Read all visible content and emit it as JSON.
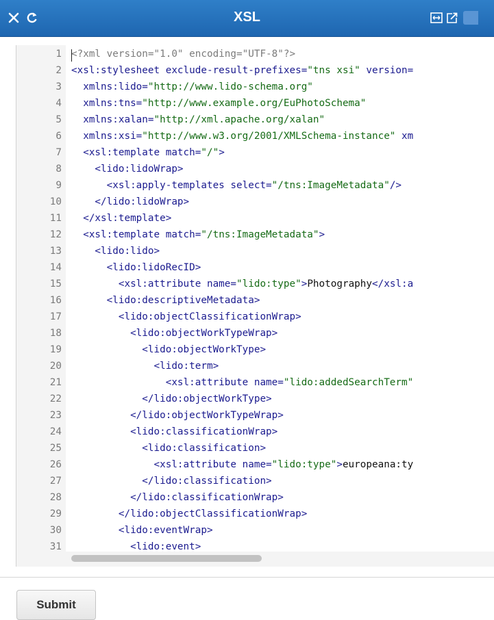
{
  "header": {
    "title": "XSL",
    "close_icon": "close-icon",
    "refresh_icon": "refresh-icon",
    "expand_icon": "expand-icon",
    "share_icon": "share-icon"
  },
  "colors": {
    "header_bg": "#1e66b0",
    "tag": "#1b1b8f",
    "attr_value": "#166b16",
    "line_number": "#7a7a7a"
  },
  "editor": {
    "lines": [
      {
        "n": "1",
        "segments": [
          {
            "t": "<?xml version=\"1.0\" encoding=\"UTF-8\"?>",
            "c": "pi"
          }
        ]
      },
      {
        "n": "2",
        "segments": [
          {
            "t": "<xsl:stylesheet exclude-result-prefixes=",
            "c": "tag"
          },
          {
            "t": "\"tns xsi\"",
            "c": "val"
          },
          {
            "t": " version=",
            "c": "tag"
          }
        ]
      },
      {
        "n": "3",
        "segments": [
          {
            "t": "  xmlns:lido=",
            "c": "tag"
          },
          {
            "t": "\"http://www.lido-schema.org\"",
            "c": "val"
          }
        ]
      },
      {
        "n": "4",
        "segments": [
          {
            "t": "  xmlns:tns=",
            "c": "tag"
          },
          {
            "t": "\"http://www.example.org/EuPhotoSchema\"",
            "c": "val"
          }
        ]
      },
      {
        "n": "5",
        "segments": [
          {
            "t": "  xmlns:xalan=",
            "c": "tag"
          },
          {
            "t": "\"http://xml.apache.org/xalan\"",
            "c": "val"
          }
        ]
      },
      {
        "n": "6",
        "segments": [
          {
            "t": "  xmlns:xsi=",
            "c": "tag"
          },
          {
            "t": "\"http://www.w3.org/2001/XMLSchema-instance\"",
            "c": "val"
          },
          {
            "t": " xm",
            "c": "tag"
          }
        ]
      },
      {
        "n": "7",
        "segments": [
          {
            "t": "  <xsl:template match=",
            "c": "tag"
          },
          {
            "t": "\"/\"",
            "c": "val"
          },
          {
            "t": ">",
            "c": "tag"
          }
        ]
      },
      {
        "n": "8",
        "segments": [
          {
            "t": "    <lido:lidoWrap>",
            "c": "tag"
          }
        ]
      },
      {
        "n": "9",
        "segments": [
          {
            "t": "      <xsl:apply-templates select=",
            "c": "tag"
          },
          {
            "t": "\"/tns:ImageMetadata\"",
            "c": "val"
          },
          {
            "t": "/>",
            "c": "tag"
          }
        ]
      },
      {
        "n": "10",
        "segments": [
          {
            "t": "    </lido:lidoWrap>",
            "c": "tag"
          }
        ]
      },
      {
        "n": "11",
        "segments": [
          {
            "t": "  </xsl:template>",
            "c": "tag"
          }
        ]
      },
      {
        "n": "12",
        "segments": [
          {
            "t": "  <xsl:template match=",
            "c": "tag"
          },
          {
            "t": "\"/tns:ImageMetadata\"",
            "c": "val"
          },
          {
            "t": ">",
            "c": "tag"
          }
        ]
      },
      {
        "n": "13",
        "segments": [
          {
            "t": "    <lido:lido>",
            "c": "tag"
          }
        ]
      },
      {
        "n": "14",
        "segments": [
          {
            "t": "      <lido:lidoRecID>",
            "c": "tag"
          }
        ]
      },
      {
        "n": "15",
        "segments": [
          {
            "t": "        <xsl:attribute name=",
            "c": "tag"
          },
          {
            "t": "\"lido:type\"",
            "c": "val"
          },
          {
            "t": ">",
            "c": "tag"
          },
          {
            "t": "Photography",
            "c": "txt"
          },
          {
            "t": "</xsl:a",
            "c": "tag"
          }
        ]
      },
      {
        "n": "16",
        "segments": [
          {
            "t": "      <lido:descriptiveMetadata>",
            "c": "tag"
          }
        ]
      },
      {
        "n": "17",
        "segments": [
          {
            "t": "        <lido:objectClassificationWrap>",
            "c": "tag"
          }
        ]
      },
      {
        "n": "18",
        "segments": [
          {
            "t": "          <lido:objectWorkTypeWrap>",
            "c": "tag"
          }
        ]
      },
      {
        "n": "19",
        "segments": [
          {
            "t": "            <lido:objectWorkType>",
            "c": "tag"
          }
        ]
      },
      {
        "n": "20",
        "segments": [
          {
            "t": "              <lido:term>",
            "c": "tag"
          }
        ]
      },
      {
        "n": "21",
        "segments": [
          {
            "t": "                <xsl:attribute name=",
            "c": "tag"
          },
          {
            "t": "\"lido:addedSearchTerm\"",
            "c": "val"
          }
        ]
      },
      {
        "n": "22",
        "segments": [
          {
            "t": "            </lido:objectWorkType>",
            "c": "tag"
          }
        ]
      },
      {
        "n": "23",
        "segments": [
          {
            "t": "          </lido:objectWorkTypeWrap>",
            "c": "tag"
          }
        ]
      },
      {
        "n": "24",
        "segments": [
          {
            "t": "          <lido:classificationWrap>",
            "c": "tag"
          }
        ]
      },
      {
        "n": "25",
        "segments": [
          {
            "t": "            <lido:classification>",
            "c": "tag"
          }
        ]
      },
      {
        "n": "26",
        "segments": [
          {
            "t": "              <xsl:attribute name=",
            "c": "tag"
          },
          {
            "t": "\"lido:type\"",
            "c": "val"
          },
          {
            "t": ">",
            "c": "tag"
          },
          {
            "t": "europeana:ty",
            "c": "txt"
          }
        ]
      },
      {
        "n": "27",
        "segments": [
          {
            "t": "            </lido:classification>",
            "c": "tag"
          }
        ]
      },
      {
        "n": "28",
        "segments": [
          {
            "t": "          </lido:classificationWrap>",
            "c": "tag"
          }
        ]
      },
      {
        "n": "29",
        "segments": [
          {
            "t": "        </lido:objectClassificationWrap>",
            "c": "tag"
          }
        ]
      },
      {
        "n": "30",
        "segments": [
          {
            "t": "        <lido:eventWrap>",
            "c": "tag"
          }
        ]
      },
      {
        "n": "31",
        "segments": [
          {
            "t": "          <lido:event>",
            "c": "tag"
          }
        ]
      }
    ]
  },
  "footer": {
    "submit_label": "Submit"
  }
}
